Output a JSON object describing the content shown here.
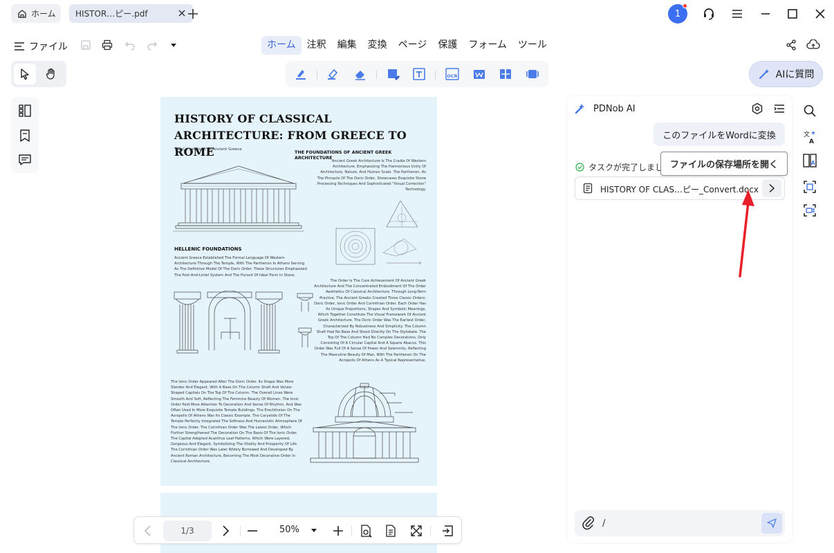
{
  "tabs": {
    "home_label": "ホーム",
    "file_label": "HISTOR…ピー.pdf"
  },
  "account": {
    "notification_count": "1"
  },
  "menu": {
    "file_label": "ファイル",
    "items": [
      "ホーム",
      "注釈",
      "編集",
      "変換",
      "ページ",
      "保護",
      "フォーム",
      "ツール"
    ],
    "active": "ホーム"
  },
  "ai_button": {
    "label": "AIに質問"
  },
  "document": {
    "title": "HISTORY OF CLASSICAL  ARCHITECTURE: FROM GREECE TO ROME",
    "subtitle": "The Cornerstone Of Ancient Greece",
    "heading_foundations": "THE FOUNDATIONS OF ANCIENT GREEK ARCHITECTURE",
    "text_foundations": "Ancient Greek Architecture Is The Cradle Of Western Architecture, Emphasizing The Harmonious Unity Of Architecture, Nature, And Human Scale. The Parthenon, As The Pinnacle Of The Doric Order, Showcases Exquisite Stone Processing Techniques And Sophisticated \"Visual Correction\" Technology.",
    "heading_hellenic": "HELLENIC FOUNDATIONS",
    "text_hellenic": "Ancient Greece Established The Formal Language Of Western Architecture Through The Temple, With The Parthenon In Athens Serving As The Definitive Model Of The Doric Order. These Structures Emphasized The Post-And-Lintel System And The Pursuit Of Ideal Form In Stone.",
    "text_order": "The Order Is The Core Achievement Of Ancient Greek Architecture And The Concentrated Embodiment Of The Order Aesthetics Of Classical Architecture. Through Long-Term Practice, The Ancient Greeks Created Three Classic Orders: Doric Order, Ionic Order And Corinthian Order. Each Order Has Its Unique Proportions, Shapes And Symbolic Meanings, Which Together Constitute The Visual Framework Of Ancient Greek Architecture. The Doric Order Was The Earliest Order, Characterized By Robustness And Simplicity. The Column Shaft Had No Base And Stood Directly On The Stylobate. The Top Of The Column Had No Complex Decorations, Only Consisting Of A Circular Capital And A Square Abacus. This Order Was Full Of A Sense Of Power And Solemnity, Reflecting The Masculine Beauty Of Man, With The Parthenon On The Acropolis Of Athens As A Typical Representative.",
    "text_ionic": "The Ionic Order Appeared After The Doric Order. Its Shape Was More Slender And Elegant, With A Base On The Column Shaft And Volute-Shaped Capitals On The Top Of The Column. The Overall Lines Were Smooth And Soft, Reflecting The Feminine Beauty Of Women. The Ionic Order Paid More Attention To Decoration And Sense Of Rhythm, And Was Often Used In More Exquisite Temple Buildings. The Erechtheion On The Acropolis Of Athens Was Its Classic Example. The Caryatids Of The Temple Perfectly Integrated The Softness And Humanistic Atmosphere Of The Ionic Order. The Corinthian Order Was The Latest Order, Which Further Strengthened The Decoration On The Basis Of The Ionic Order. The Capital Adopted Acanthus Leaf Patterns, Which Were Layered, Gorgeous And Elegant, Symbolizing The Vitality And Prosperity Of Life. The Corinthian Order Was Later Widely Borrowed And Developed By Ancient Roman Architecture, Becoming The Most Decorative Order In Classical Architecture."
  },
  "pagebar": {
    "page_indicator": "1/3",
    "zoom": "50%"
  },
  "ai_panel": {
    "title": "PDNob AI",
    "user_message": "このファイルをWordに変換",
    "task_status": "タスクが完了しました",
    "tooltip": "ファイルの保存場所を開く",
    "file_name": "HISTORY OF CLAS…ピー_Convert.docx",
    "input_value": "/"
  },
  "colors": {
    "accent": "#3a62d8",
    "page_bg": "#e5f4fb",
    "annotation_arrow": "#e8202a",
    "success": "#2bb24c"
  }
}
